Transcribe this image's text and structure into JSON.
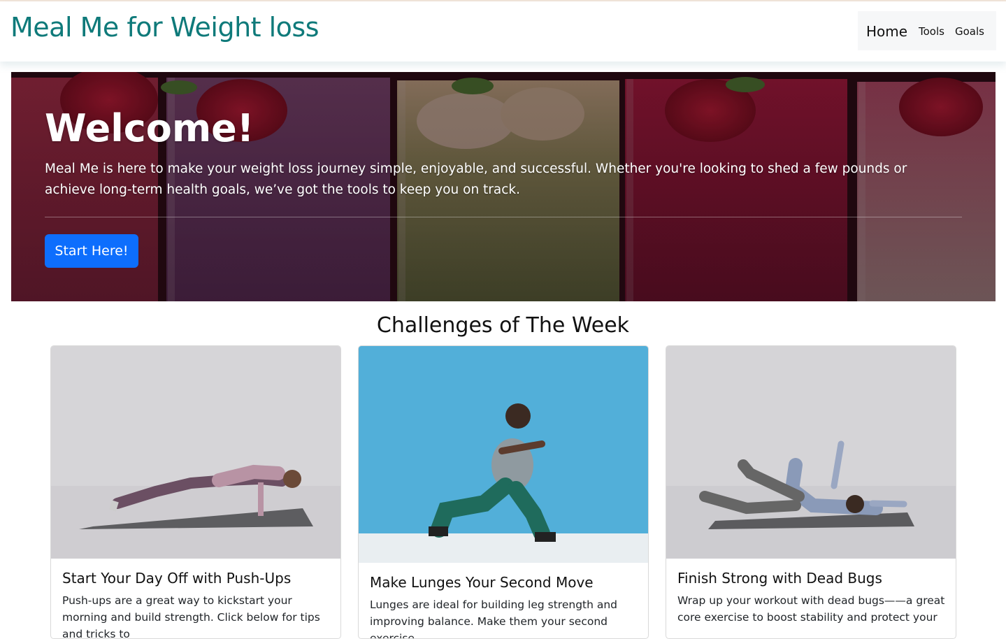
{
  "header": {
    "brand": "Meal Me for Weight loss",
    "nav": {
      "home": "Home",
      "tools": "Tools",
      "goals": "Goals"
    }
  },
  "hero": {
    "title": "Welcome!",
    "text": "Meal Me is here to make your weight loss journey simple, enjoyable, and successful. Whether you're looking to shed a few pounds or achieve long-term health goals, we’ve got the tools to keep you on track.",
    "button_label": "Start Here!",
    "background": "smoothies-photo"
  },
  "challenges": {
    "title": "Challenges of The Week",
    "cards": [
      {
        "image": "push-up-photo",
        "title": "Start Your Day Off with Push-Ups",
        "text": "Push-ups are a great way to kickstart your morning and build strength. Click below for tips and tricks to"
      },
      {
        "image": "lunge-photo",
        "title": "Make Lunges Your Second Move",
        "text": "Lunges are ideal for building leg strength and improving balance. Make them your second exercise"
      },
      {
        "image": "dead-bug-photo",
        "title": "Finish Strong with Dead Bugs",
        "text": "Wrap up your workout with dead bugs——a great core exercise to boost stability and protect your"
      }
    ]
  },
  "colors": {
    "brand": "#0f7a7a",
    "primary_button": "#0d6efd",
    "nav_bg": "#f6f7f8"
  }
}
